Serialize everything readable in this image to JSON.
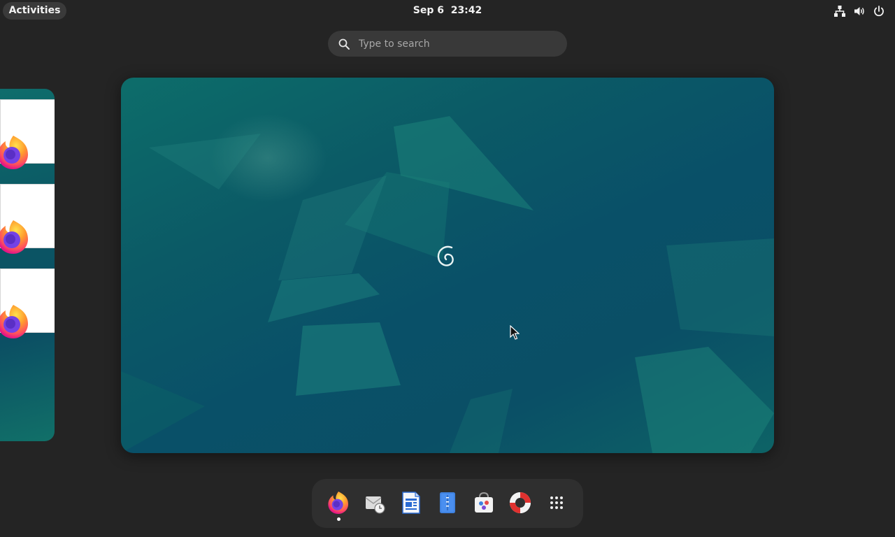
{
  "topbar": {
    "activities_label": "Activities",
    "clock_text": "Sep 6  23:42",
    "status_icons": [
      "network-icon",
      "volume-icon",
      "power-icon"
    ]
  },
  "search": {
    "placeholder": "Type to search",
    "value": ""
  },
  "workspaces": {
    "previous": {
      "windows": [
        "firefox-window",
        "firefox-window",
        "firefox-window"
      ]
    },
    "current": {
      "wallpaper": "debian-wallpaper"
    }
  },
  "dock": {
    "apps": [
      {
        "name": "firefox",
        "icon": "firefox-icon",
        "running": true
      },
      {
        "name": "evolution",
        "icon": "mail-clock-icon",
        "running": false
      },
      {
        "name": "writer",
        "icon": "document-icon",
        "running": false
      },
      {
        "name": "text-editor",
        "icon": "text-editor-icon",
        "running": false
      },
      {
        "name": "software",
        "icon": "software-center-icon",
        "running": false
      },
      {
        "name": "help",
        "icon": "help-lifebuoy-icon",
        "running": false
      },
      {
        "name": "show-apps",
        "icon": "app-grid-icon",
        "running": false
      }
    ]
  },
  "colors": {
    "background": "#242424",
    "panel_pill": "#3a3a3a",
    "search_bg": "#393939",
    "dock_bg": "#2f2f2f",
    "wallpaper_teal": "#0b5a66",
    "firefox_orange": "#ff7139",
    "firefox_purple": "#7542e5"
  }
}
